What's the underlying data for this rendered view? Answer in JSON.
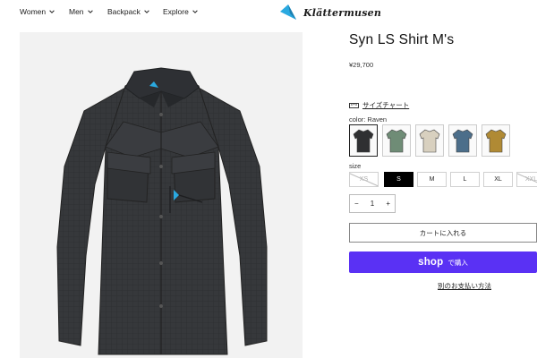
{
  "nav": {
    "items": [
      {
        "label": "Women"
      },
      {
        "label": "Men"
      },
      {
        "label": "Backpack"
      },
      {
        "label": "Explore"
      }
    ]
  },
  "brand": {
    "name": "Klättermusen",
    "color": "#2aa9e0"
  },
  "product": {
    "title": "Syn LS Shirt M's",
    "price": "¥29,700",
    "size_chart_label": "サイズチャート",
    "color_label": "color: Raven",
    "colors": [
      {
        "name": "Raven",
        "hex": "#2f3032",
        "selected": true
      },
      {
        "name": "sage",
        "hex": "#6f8c76",
        "selected": false
      },
      {
        "name": "sand",
        "hex": "#d8d0bf",
        "selected": false
      },
      {
        "name": "blue",
        "hex": "#4c6e8a",
        "selected": false
      },
      {
        "name": "ochre",
        "hex": "#b08a34",
        "selected": false
      }
    ],
    "size_label": "size",
    "sizes": [
      {
        "label": "XS",
        "state": "soldout"
      },
      {
        "label": "S",
        "state": "selected"
      },
      {
        "label": "M",
        "state": "available"
      },
      {
        "label": "L",
        "state": "available"
      },
      {
        "label": "XL",
        "state": "available"
      },
      {
        "label": "XXL",
        "state": "soldout"
      }
    ],
    "quantity": {
      "minus": "−",
      "value": "1",
      "plus": "+"
    },
    "add_to_cart_label": "カートに入れる",
    "shop_pay": {
      "brand": "shop",
      "suffix": "で購入",
      "color": "#5a31f4"
    },
    "other_payment_label": "別のお支払い方法"
  }
}
